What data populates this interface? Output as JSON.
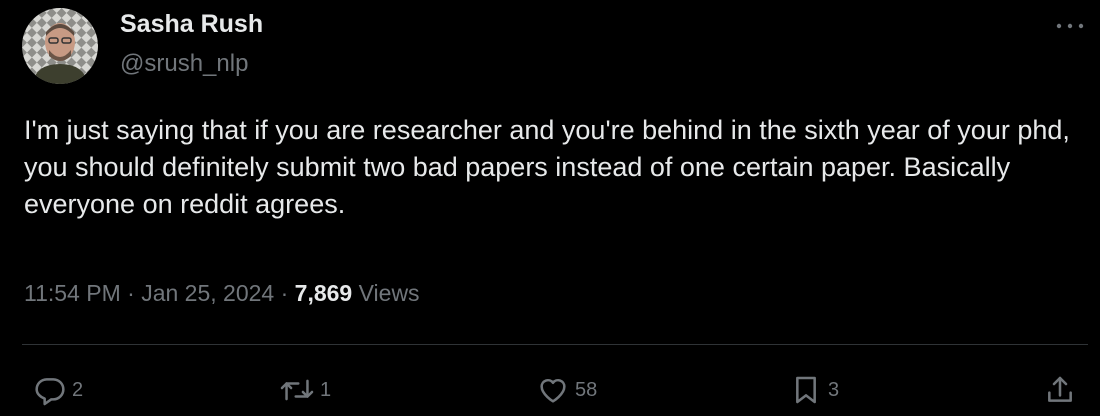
{
  "author": {
    "display_name": "Sasha Rush",
    "handle": "@srush_nlp",
    "avatar_icon": "user-avatar-photo"
  },
  "tweet": {
    "text": "I'm just saying that if you are researcher and you're behind in the sixth year of your phd, you should definitely submit two bad papers instead of one certain paper. Basically everyone on reddit agrees.",
    "time": "11:54 PM",
    "date": "Jan 25, 2024",
    "separator": "·",
    "views_count": "7,869",
    "views_label": "Views"
  },
  "actions": {
    "reply": {
      "icon": "reply-icon",
      "count": "2"
    },
    "retweet": {
      "icon": "retweet-icon",
      "count": "1"
    },
    "like": {
      "icon": "heart-icon",
      "count": "58"
    },
    "bookmark": {
      "icon": "bookmark-icon",
      "count": "3"
    },
    "share": {
      "icon": "share-icon"
    }
  },
  "colors": {
    "background": "#000000",
    "primary_text": "#e7e9ea",
    "secondary_text": "#71767b",
    "divider": "#2f3336"
  }
}
